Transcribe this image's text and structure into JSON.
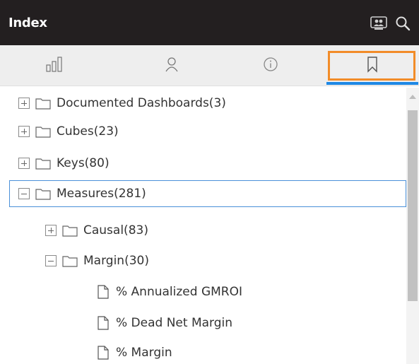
{
  "header": {
    "title": "Index",
    "icons": [
      "people-icon",
      "search-icon"
    ]
  },
  "tabs": [
    {
      "name": "charts-tab",
      "icon": "bar-chart-icon"
    },
    {
      "name": "user-tab",
      "icon": "user-icon"
    },
    {
      "name": "info-tab",
      "icon": "info-icon"
    },
    {
      "name": "bookmark-tab",
      "icon": "bookmark-icon",
      "active": true
    }
  ],
  "tree": {
    "items": [
      {
        "label": "Documented Dashboards(3)",
        "toggle": "plus",
        "type": "folder"
      },
      {
        "label": "Cubes(23)",
        "toggle": "plus",
        "type": "folder"
      },
      {
        "label": "Keys(80)",
        "toggle": "plus",
        "type": "folder"
      },
      {
        "label": "Measures(281)",
        "toggle": "minus",
        "type": "folder",
        "selected": true
      },
      {
        "label": "Causal(83)",
        "toggle": "plus",
        "type": "folder"
      },
      {
        "label": "Margin(30)",
        "toggle": "minus",
        "type": "folder"
      },
      {
        "label": "% Annualized GMROI",
        "type": "file"
      },
      {
        "label": "% Dead Net Margin",
        "type": "file"
      },
      {
        "label": "% Margin",
        "type": "file"
      }
    ]
  },
  "colors": {
    "header_bg": "#231f20",
    "tab_bar_bg": "#eeeeee",
    "active_tab_focus": "#f28c28",
    "active_tab_underline": "#1e88e5",
    "selected_border": "#4a90d9"
  }
}
